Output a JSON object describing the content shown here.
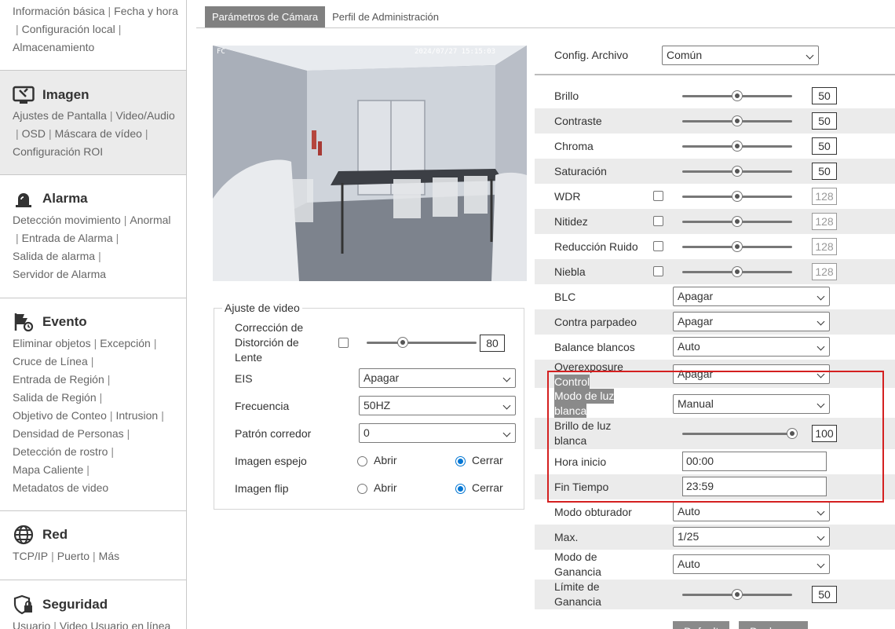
{
  "sidebar": {
    "basic": {
      "row1": [
        "Información básica",
        "Fecha y hora"
      ],
      "row2": [
        "Configuración local"
      ],
      "row3": [
        "Almacenamiento"
      ]
    },
    "imagen": {
      "title": "Imagen",
      "row1": [
        "Ajustes de Pantalla",
        "Video/Audio"
      ],
      "row2": [
        "OSD",
        "Máscara de vídeo"
      ],
      "row3": [
        "Configuración ROI"
      ]
    },
    "alarma": {
      "title": "Alarma",
      "row1": [
        "Detección movimiento",
        "Anormal"
      ],
      "row2": [
        "Entrada de Alarma"
      ],
      "row3": [
        "Salida de alarma"
      ],
      "row4": [
        "Servidor de Alarma"
      ]
    },
    "evento": {
      "title": "Evento",
      "rows": [
        [
          "Eliminar objetos",
          "Excepción"
        ],
        [
          "Cruce de Línea"
        ],
        [
          "Entrada de Región"
        ],
        [
          "Salida de Región"
        ],
        [
          "Objetivo de Conteo",
          "Intrusion"
        ],
        [
          "Densidad de Personas"
        ],
        [
          "Detección de rostro"
        ],
        [
          "Mapa Caliente"
        ],
        [
          "Metadatos de video"
        ]
      ]
    },
    "red": {
      "title": "Red",
      "row1": [
        "TCP/IP",
        "Puerto",
        "Más"
      ]
    },
    "seguridad": {
      "title": "Seguridad",
      "row1": [
        "Usuario",
        "Video Usuario en línea"
      ]
    }
  },
  "tabs": [
    "Parámetros de Cámara",
    "Perfil de Administración"
  ],
  "preview": {
    "osd_left": "FC",
    "osd_right": "2024/07/27 15:15:03"
  },
  "video": {
    "title": "Ajuste de video",
    "lens_label": [
      "Corrección de",
      "Distorción de",
      "Lente"
    ],
    "lens_value": "80",
    "eis_label": "EIS",
    "eis_value": "Apagar",
    "freq_label": "Frecuencia",
    "freq_value": "50HZ",
    "corridor_label": "Patrón corredor",
    "corridor_value": "0",
    "mirror_label": "Imagen espejo",
    "flip_label": "Imagen flip",
    "open": "Abrir",
    "close": "Cerrar"
  },
  "config": {
    "label": "Config. Archivo",
    "value": "Común"
  },
  "params": {
    "brillo": {
      "label": "Brillo",
      "value": "50",
      "level": 0.5
    },
    "contraste": {
      "label": "Contraste",
      "value": "50",
      "level": 0.5
    },
    "chroma": {
      "label": "Chroma",
      "value": "50",
      "level": 0.5
    },
    "saturacion": {
      "label": "Saturación",
      "value": "50",
      "level": 0.5
    },
    "wdr": {
      "label": "WDR",
      "value": "128",
      "level": 0.5
    },
    "nitidez": {
      "label": "Nitidez",
      "value": "128",
      "level": 0.5
    },
    "ruido": {
      "label": "Reducción Ruido",
      "value": "128",
      "level": 0.5
    },
    "niebla": {
      "label": "Niebla",
      "value": "128",
      "level": 0.5
    },
    "blc": {
      "label": "BLC",
      "value": "Apagar"
    },
    "parpadeo": {
      "label": "Contra parpadeo",
      "value": "Apagar"
    },
    "balance": {
      "label": "Balance blancos",
      "value": "Auto"
    },
    "overexposure": {
      "label1": "Overexposure",
      "label2": "Control",
      "value": "Apagar"
    },
    "modoluz": {
      "label1": "Modo de luz",
      "label2": "blanca",
      "value": "Manual"
    },
    "brilloluz": {
      "label1": "Brillo de luz",
      "label2": "blanca",
      "value": "100",
      "level": 1.0
    },
    "horainicio": {
      "label": "Hora inicio",
      "value": "00:00"
    },
    "fintiempo": {
      "label": "Fin Tiempo",
      "value": "23:59"
    },
    "obturador": {
      "label": "Modo obturador",
      "value": "Auto"
    },
    "max": {
      "label": "Max.",
      "value": "1/25"
    },
    "ganancia": {
      "label1": "Modo de",
      "label2": "Ganancia",
      "value": "Auto"
    },
    "limite": {
      "label1": "Límite de",
      "label2": "Ganancia",
      "value": "50",
      "level": 0.5
    }
  },
  "buttons": {
    "default": "Default",
    "redo": "Deshacer"
  },
  "colors": {
    "active_tab": "#808080",
    "highlight_box": "#d42020",
    "radio_accent": "#0075d3"
  }
}
